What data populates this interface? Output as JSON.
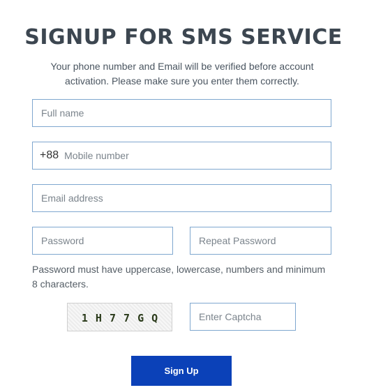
{
  "form": {
    "title": "SIGNUP FOR SMS SERVICE",
    "subtitle": "Your phone number and Email will be verified before account activation. Please make sure you enter them correctly.",
    "full_name": {
      "placeholder": "Full name",
      "value": ""
    },
    "mobile": {
      "prefix": "+88",
      "placeholder": "Mobile number",
      "value": ""
    },
    "email": {
      "placeholder": "Email address",
      "value": ""
    },
    "password": {
      "placeholder": "Password",
      "value": ""
    },
    "repeat_password": {
      "placeholder": "Repeat Password",
      "value": ""
    },
    "password_hint": "Password must have uppercase, lowercase, numbers and minimum 8 characters.",
    "captcha": {
      "text": "1 H 7 7 G Q",
      "input_placeholder": "Enter Captcha",
      "value": ""
    },
    "submit_label": "Sign Up"
  },
  "colors": {
    "title": "#3c4650",
    "field_border": "#7fa7cf",
    "button_bg": "#0b41b8",
    "button_text": "#ffffff"
  }
}
